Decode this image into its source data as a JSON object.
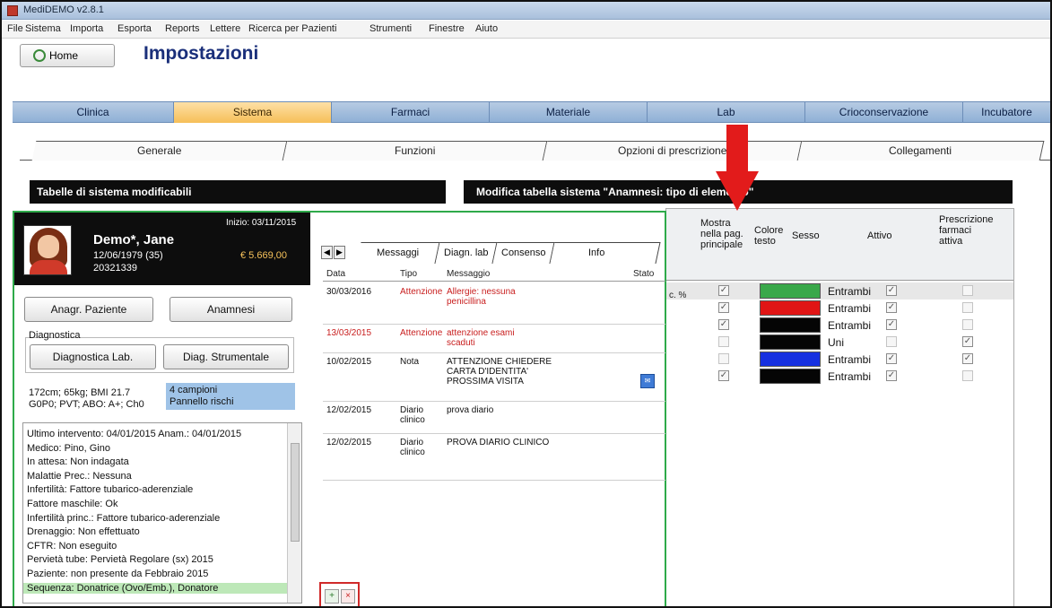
{
  "window": {
    "title": "MediDEMO v2.8.1"
  },
  "menu": [
    "File",
    "Sistema",
    "Importa",
    "Esporta",
    "Reports",
    "Lettere",
    "Ricerca per Pazienti",
    "Strumenti",
    "Finestre",
    "Aiuto"
  ],
  "home_button": "Home",
  "page_title": "Impostazioni",
  "main_tabs": [
    "Clinica",
    "Sistema",
    "Farmaci",
    "Materiale",
    "Lab",
    "Crioconservazione",
    "Incubatore"
  ],
  "sub_tabs": [
    "Generale",
    "Funzioni",
    "Opzioni di prescrizione",
    "Collegamenti"
  ],
  "sys_table_title": "Tabelle di sistema modificabili",
  "edit_table_title": "Modifica tabella sistema \"Anamnesi: tipo di elemento\"",
  "grid": {
    "headers": {
      "show": "Mostra nella pag. principale",
      "color": "Colore testo",
      "sex": "Sesso",
      "active": "Attivo",
      "prescribe": "Prescrizione farmaci attiva"
    },
    "stub": "c. %",
    "rows": [
      {
        "show": "✓",
        "color": "#3aa84a",
        "sex": "Entrambi",
        "active": "✓",
        "prescribe": ""
      },
      {
        "show": "✓",
        "color": "#e01515",
        "sex": "Entrambi",
        "active": "✓",
        "prescribe": ""
      },
      {
        "show": "✓",
        "color": "#050505",
        "sex": "Entrambi",
        "active": "✓",
        "prescribe": ""
      },
      {
        "show": "",
        "color": "#050505",
        "sex": "Uni",
        "active": "",
        "prescribe": "✓"
      },
      {
        "show": "",
        "color": "#1630e0",
        "sex": "Entrambi",
        "active": "✓",
        "prescribe": "✓"
      },
      {
        "show": "✓",
        "color": "#050505",
        "sex": "Entrambi",
        "active": "✓",
        "prescribe": ""
      }
    ]
  },
  "patient": {
    "name": "Demo*, Jane",
    "dob": "12/06/1979 (35)",
    "id": "20321339",
    "bed": "Inizio: 03/11/2015",
    "amount": "€ 5.669,00"
  },
  "buttons": {
    "anagrafica": "Anagr. Paziente",
    "anamnesi": "Anamnesi",
    "diag_group": "Diagnostica",
    "diag_lab": "Diagnostica Lab.",
    "diag_strum": "Diag. Strumentale"
  },
  "vitals": {
    "line1": "172cm; 65kg; BMI 21.7",
    "line2": "G0P0; PVT; ABO: A+; Ch0",
    "campioni": "4 campioni",
    "campioni_sub": "Pannello rischi"
  },
  "notes": [
    "Ultimo intervento: 04/01/2015   Anam.: 04/01/2015",
    "Medico: Pino, Gino",
    "In attesa: Non indagata",
    "Malattie Prec.: Nessuna",
    "Infertilità: Fattore tubarico-aderenziale",
    "Fattore maschile: Ok",
    "Infertilità princ.: Fattore tubarico-aderenziale",
    "Drenaggio: Non effettuato",
    "CFTR: Non eseguito",
    "Pervietà tube: Pervietà Regolare (sx) 2015",
    "Paziente: non presente da Febbraio 2015",
    "Sequenza: Donatrice (Ovo/Emb.), Donatore"
  ],
  "patient_tabs": [
    "Messaggi",
    "Diagn. lab",
    "Consenso",
    "Info"
  ],
  "msg_headers": {
    "date": "Data",
    "type": "Tipo",
    "msg": "Messaggio",
    "state": "Stato"
  },
  "messages": [
    {
      "date": "30/03/2016",
      "type": "Attenzione",
      "msg": "Allergie: nessuna\npenicillina",
      "red": true
    },
    {
      "date": "13/03/2015",
      "type": "Attenzione",
      "msg": "attenzione esami\nscaduti",
      "red": true
    },
    {
      "date": "10/02/2015",
      "type": "Nota",
      "msg": "ATTENZIONE CHIEDERE\nCARTA D'IDENTITA'\nPROSSIMA VISITA",
      "red": false
    },
    {
      "date": "12/02/2015",
      "type": "Diario\nclinico",
      "msg": "prova diario",
      "red": false
    },
    {
      "date": "12/02/2015",
      "type": "Diario\nclinico",
      "msg": "PROVA DIARIO CLINICO",
      "red": false
    }
  ],
  "colors": {
    "accent_green": "#2eaa4a",
    "arrow_red": "#e21b1b",
    "tab_active": "#f6bf58",
    "tab_blue": "#8fb0d6"
  }
}
